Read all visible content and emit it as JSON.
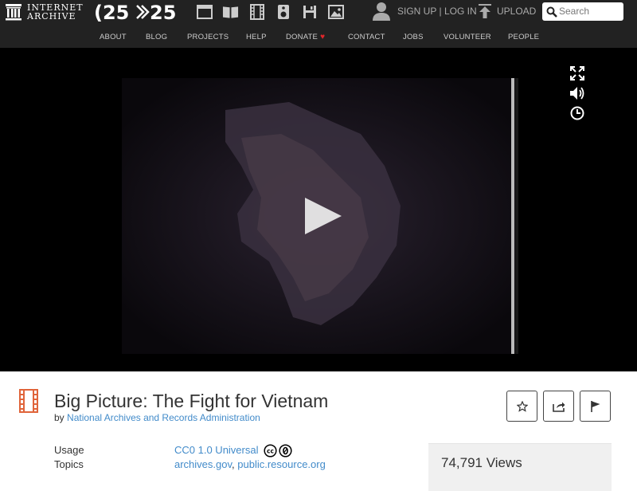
{
  "header": {
    "logo_lines": [
      "INTERNET",
      "ARCHIVE"
    ],
    "anniversary_logo": "25 >> 25",
    "media_icons": [
      "web-icon",
      "texts-icon",
      "video-icon",
      "audio-icon",
      "software-icon",
      "images-icon"
    ],
    "signup_label": "SIGN UP",
    "login_label": "LOG IN",
    "divider": "|",
    "upload_label": "UPLOAD",
    "search_placeholder": "Search"
  },
  "nav": {
    "items": [
      "ABOUT",
      "BLOG",
      "PROJECTS",
      "HELP",
      "DONATE",
      "CONTACT",
      "JOBS",
      "VOLUNTEER",
      "PEOPLE"
    ],
    "donate_heart": "♥"
  },
  "player": {
    "controls": [
      "fullscreen-icon",
      "volume-icon",
      "clock-icon"
    ]
  },
  "item": {
    "title": "Big Picture: The Fight for Vietnam",
    "by_label": "by",
    "creator": "National Archives and Records Administration",
    "usage_label": "Usage",
    "usage_value": "CC0 1.0 Universal",
    "license_badges": [
      "cc",
      "zero"
    ],
    "topics_label": "Topics",
    "topics": [
      "archives.gov",
      "public.resource.org"
    ],
    "topics_sep": ",",
    "views": "74,791 Views"
  },
  "colors": {
    "bar_bg": "#222222",
    "link": "#428bca",
    "heart": "#e0262b",
    "film_icon": "#e0643a"
  }
}
